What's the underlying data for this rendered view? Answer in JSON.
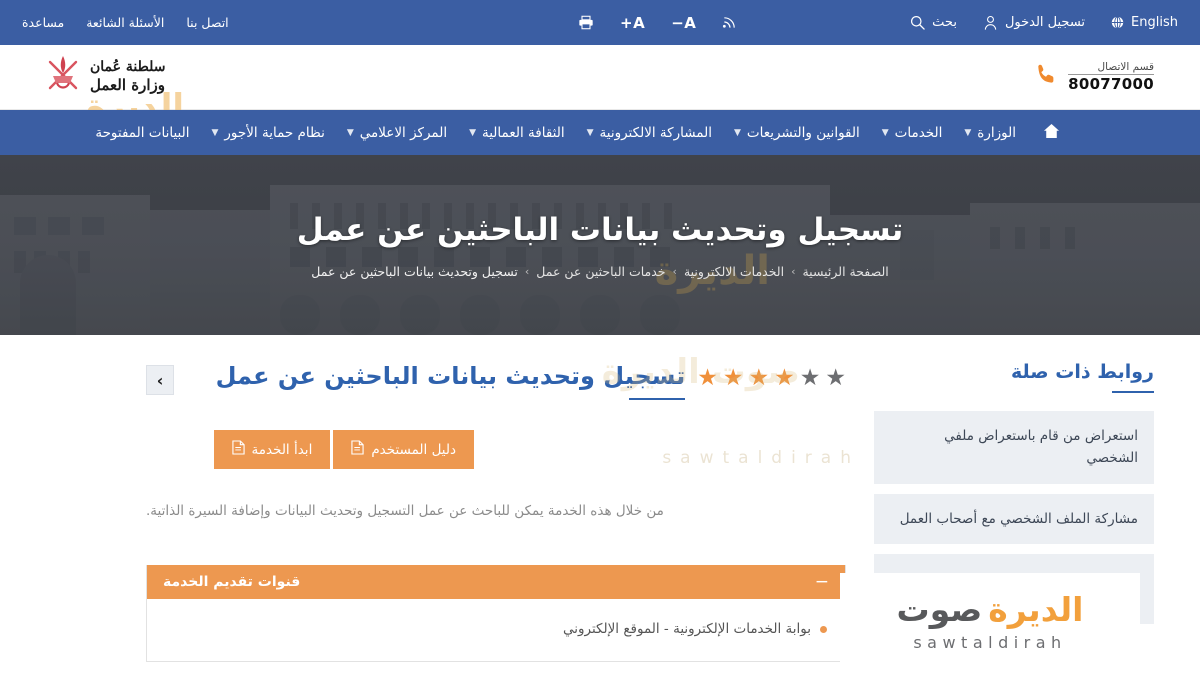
{
  "topbar": {
    "language": "English",
    "search": "بحث",
    "login": "تسجيل الدخول",
    "rss": "rss-icon",
    "font_decrease": "A−",
    "font_increase": "A+",
    "print": "print-icon",
    "links": [
      {
        "label": "اتصل بنا"
      },
      {
        "label": "الأسئلة الشائعة"
      },
      {
        "label": "مساعدة"
      }
    ]
  },
  "brand": {
    "line1": "سلطنة عُمان",
    "line2": "وزارة العمل",
    "emblem": "oman-khanjar-emblem"
  },
  "contact": {
    "label": "قسم الاتصال",
    "number": "80077000"
  },
  "nav": {
    "home": "home-icon",
    "items": [
      {
        "label": "الوزارة",
        "has_caret": true
      },
      {
        "label": "الخدمات",
        "has_caret": true
      },
      {
        "label": "القوانين والتشريعات",
        "has_caret": true
      },
      {
        "label": "المشاركة الالكترونية",
        "has_caret": true
      },
      {
        "label": "الثقافة العمالية",
        "has_caret": true
      },
      {
        "label": "المركز الاعلامي",
        "has_caret": true
      },
      {
        "label": "نظام حماية الأجور",
        "has_caret": true
      },
      {
        "label": "البيانات المفتوحة",
        "has_caret": false
      }
    ]
  },
  "hero": {
    "title": "تسجيل وتحديث بيانات الباحثين عن عمل",
    "breadcrumb": [
      "الصفحة الرئيسية",
      "الخدمات الالكترونية",
      "خدمات الباحثين عن عمل",
      "تسجيل وتحديث بيانات الباحثين عن عمل"
    ],
    "separator": "›"
  },
  "service": {
    "title": "تسجيل وتحديث بيانات الباحثين عن عمل",
    "next_arrow": "›",
    "rating": {
      "filled": 4,
      "total": 6,
      "filled_color": "#f0903a",
      "empty_color": "#6d6e71"
    },
    "buttons": [
      {
        "label": "ابدأ الخدمة",
        "icon": "document-icon"
      },
      {
        "label": "دليل المستخدم",
        "icon": "document-icon"
      }
    ],
    "description": "من خلال هذه الخدمة يمكن للباحث عن عمل التسجيل وتحديث البيانات وإضافة السيرة الذاتية."
  },
  "channels_panel": {
    "title": "قنوات تقديم الخدمة",
    "toggle": "−",
    "items": [
      "بوابة الخدمات الإلكترونية - الموقع الإلكتروني"
    ]
  },
  "sidebar": {
    "title": "روابط ذات صلة",
    "links": [
      "استعراض من قام باستعراض ملفي الشخصي",
      "مشاركة الملف الشخصي مع أصحاب العمل"
    ]
  },
  "watermark": {
    "arabic": "صوت الديرة",
    "arabic_orange": "الديرة",
    "arabic_gray": "صوت",
    "latin": "sawtaldirah"
  },
  "colors": {
    "brand_blue": "#3b5ea3",
    "accent_orange": "#ed9850",
    "link_blue": "#2f62ad",
    "hero_dark": "#3c3f46"
  }
}
